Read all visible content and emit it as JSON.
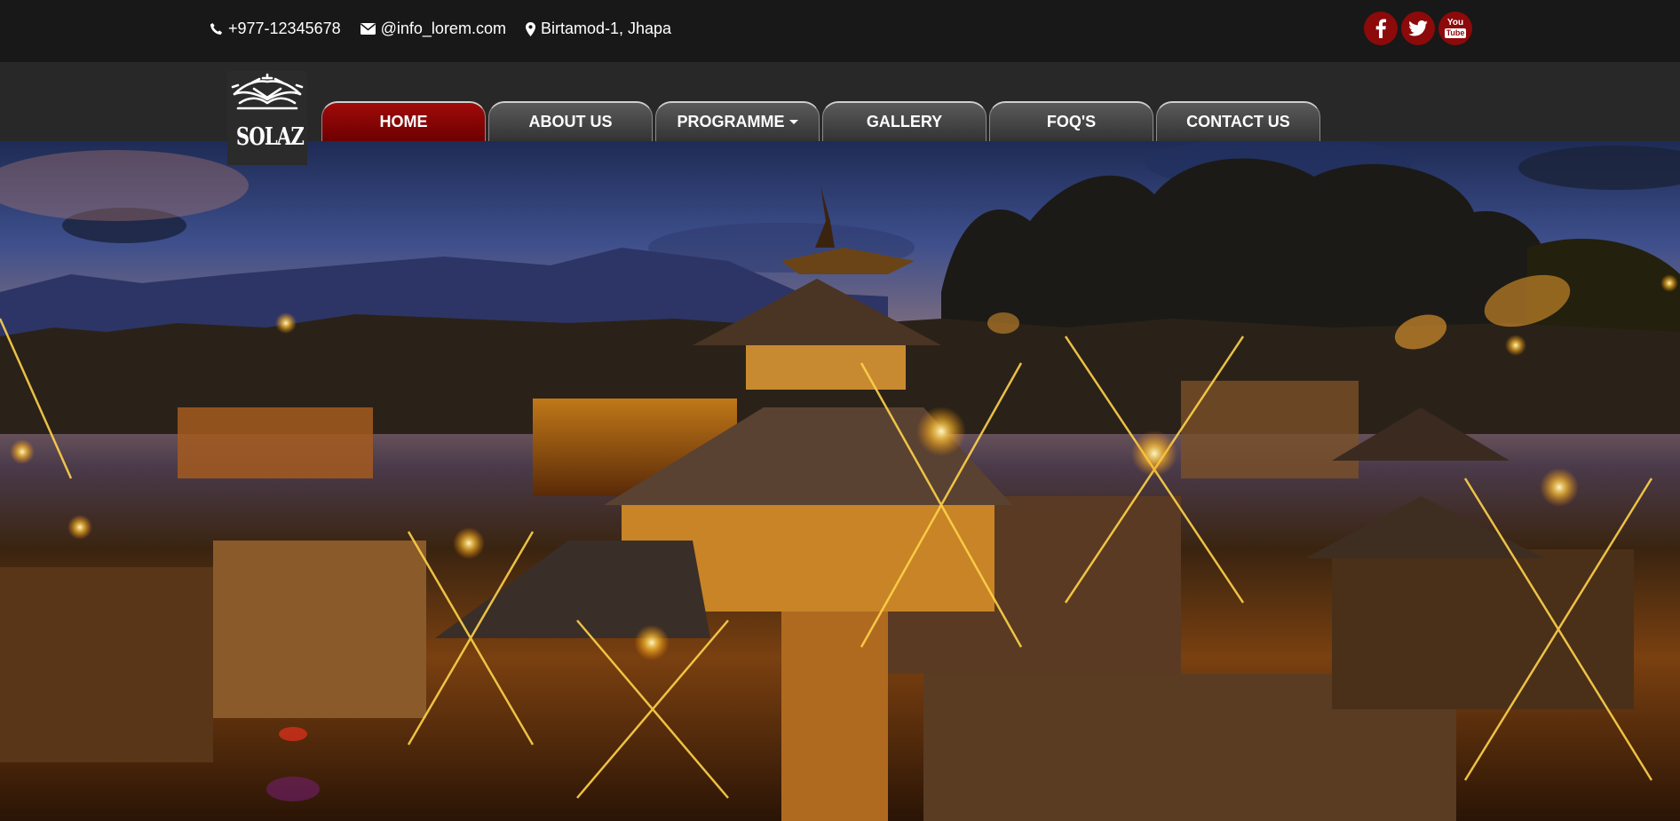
{
  "topbar": {
    "phone": "+977-12345678",
    "email": "@info_lorem.com",
    "address": "Birtamod-1, Jhapa",
    "social": {
      "facebook_icon": "facebook-icon",
      "twitter_icon": "twitter-icon",
      "youtube_top": "You",
      "youtube_box": "Tube"
    }
  },
  "logo": {
    "text": "SOLAZ"
  },
  "nav": {
    "home": "HOME",
    "about": "ABOUT US",
    "programme": "PROGRAMME",
    "gallery": "GALLERY",
    "faq": "FOQ'S",
    "contact": "CONTACT US",
    "active": "HOME"
  },
  "theme": {
    "accent": "#8c0a0a",
    "topbar_bg": "#181818",
    "navbar_bg": "#282828"
  }
}
